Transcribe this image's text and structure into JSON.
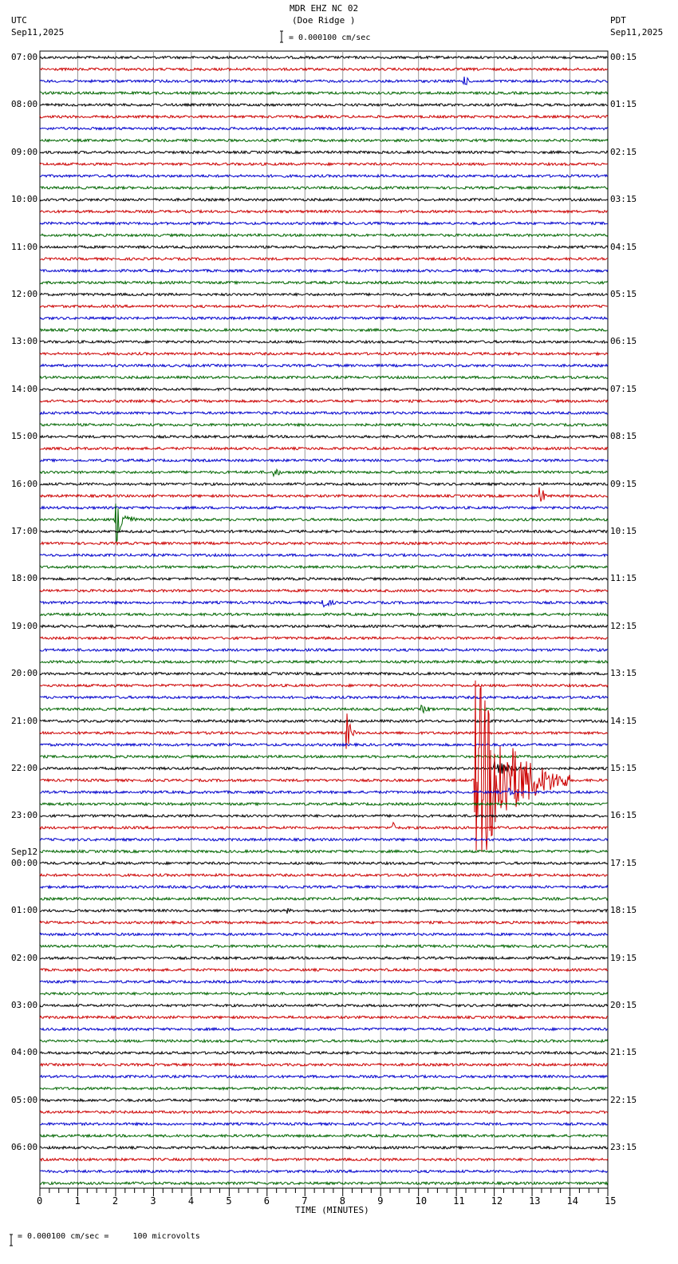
{
  "header": {
    "title": "MDR EHZ NC 02",
    "subtitle": "(Doe Ridge )",
    "left_tz": "UTC",
    "left_date": "Sep11,2025",
    "right_tz": "PDT",
    "right_date": "Sep11,2025",
    "scale_text": "= 0.000100 cm/sec"
  },
  "footer": {
    "scale_text": "= 0.000100 cm/sec =     100 microvolts"
  },
  "chart_data": {
    "type": "line",
    "title": "MDR EHZ NC 02 (Doe Ridge )",
    "xlabel": "TIME (MINUTES)",
    "xlim": [
      0,
      15
    ],
    "xticks": [
      "0",
      "1",
      "2",
      "3",
      "4",
      "5",
      "6",
      "7",
      "8",
      "9",
      "10",
      "11",
      "12",
      "13",
      "14",
      "15"
    ],
    "traces_per_hour": 4,
    "trace_count": 96,
    "trace_colors": [
      "#000000",
      "#cc0000",
      "#0000cc",
      "#006600"
    ],
    "left_labels": [
      "07:00",
      "08:00",
      "09:00",
      "10:00",
      "11:00",
      "12:00",
      "13:00",
      "14:00",
      "15:00",
      "16:00",
      "17:00",
      "18:00",
      "19:00",
      "20:00",
      "21:00",
      "22:00",
      "23:00",
      "00:00",
      "01:00",
      "02:00",
      "03:00",
      "04:00",
      "05:00",
      "06:00"
    ],
    "left_date_change": {
      "hour_index": 17,
      "label": "Sep12"
    },
    "right_labels": [
      "00:15",
      "01:15",
      "02:15",
      "03:15",
      "04:15",
      "05:15",
      "06:15",
      "07:15",
      "08:15",
      "09:15",
      "10:15",
      "11:15",
      "12:15",
      "13:15",
      "14:15",
      "15:15",
      "16:15",
      "17:15",
      "18:15",
      "19:15",
      "20:15",
      "21:15",
      "22:15",
      "23:15"
    ],
    "events": [
      {
        "trace": 2,
        "minute": 11.2,
        "amplitude": 8,
        "duration": 0.4
      },
      {
        "trace": 35,
        "minute": 6.2,
        "amplitude": 8,
        "duration": 0.4
      },
      {
        "trace": 37,
        "minute": 13.2,
        "amplitude": 18,
        "duration": 0.3
      },
      {
        "trace": 39,
        "minute": 2.0,
        "amplitude": 35,
        "duration": 0.6
      },
      {
        "trace": 46,
        "minute": 7.4,
        "amplitude": 9,
        "duration": 0.8
      },
      {
        "trace": 55,
        "minute": 10.1,
        "amplitude": 5,
        "duration": 1.0
      },
      {
        "trace": 57,
        "minute": 8.1,
        "amplitude": 28,
        "duration": 0.3
      },
      {
        "trace": 61,
        "minute": 11.5,
        "amplitude": 140,
        "duration": 2.5
      },
      {
        "trace": 60,
        "minute": 12.0,
        "amplitude": 10,
        "duration": 1.5
      },
      {
        "trace": 62,
        "minute": 12.4,
        "amplitude": 8,
        "duration": 0.3
      },
      {
        "trace": 65,
        "minute": 9.3,
        "amplitude": 10,
        "duration": 0.3
      },
      {
        "trace": 72,
        "minute": 6.5,
        "amplitude": 6,
        "duration": 0.3
      }
    ]
  }
}
